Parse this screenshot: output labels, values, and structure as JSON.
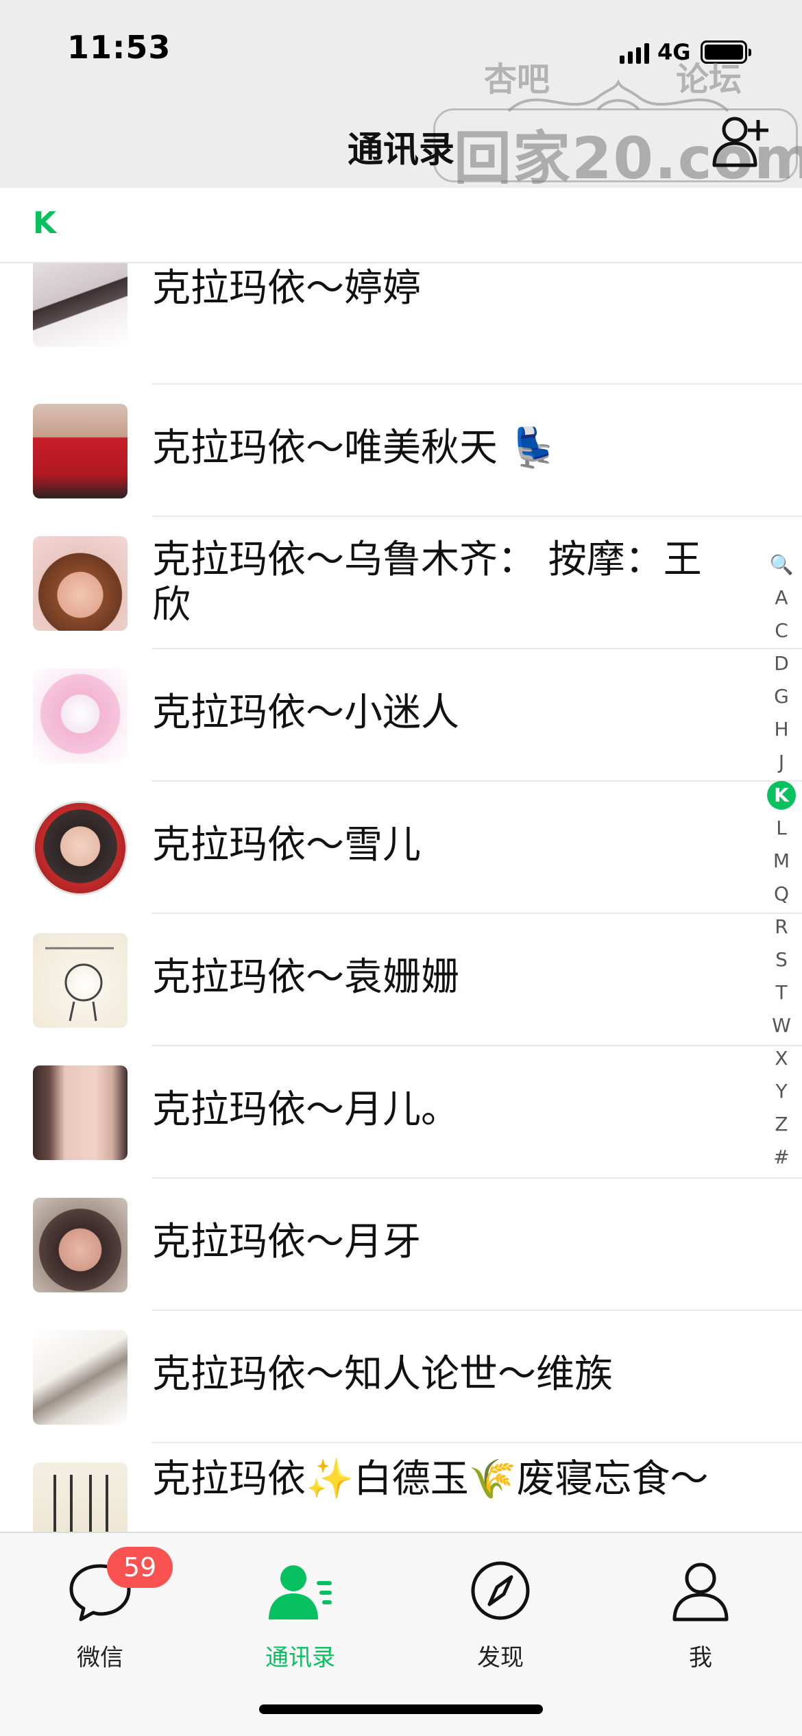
{
  "status_bar": {
    "time": "11:53",
    "network": "4G"
  },
  "nav": {
    "title": "通讯录",
    "add_friend_icon": "add-contact-icon"
  },
  "watermark": {
    "top_left": "杏吧",
    "top_right": "论坛",
    "main": "回家20.com"
  },
  "section": {
    "letter": "K"
  },
  "contacts": [
    {
      "name": "克拉玛依～婷婷"
    },
    {
      "name": "克拉玛依～唯美秋天 💺"
    },
    {
      "name": "克拉玛依～乌鲁木齐： 按摩：王欣"
    },
    {
      "name": "克拉玛依～小迷人"
    },
    {
      "name": "克拉玛依～雪儿"
    },
    {
      "name": "克拉玛依～袁姗姗"
    },
    {
      "name": "克拉玛依～月儿。"
    },
    {
      "name": "克拉玛依～月牙"
    },
    {
      "name": "克拉玛依～知人论世～维族"
    },
    {
      "name": "克拉玛依✨白德玉🌾废寝忘食～"
    }
  ],
  "index_bar": {
    "items": [
      "🔍",
      "A",
      "C",
      "D",
      "G",
      "H",
      "J",
      "K",
      "L",
      "M",
      "Q",
      "R",
      "S",
      "T",
      "W",
      "X",
      "Y",
      "Z",
      "#"
    ],
    "active": "K"
  },
  "tab_bar": {
    "tabs": [
      {
        "label": "微信",
        "icon": "chat-bubble-icon",
        "badge": "59"
      },
      {
        "label": "通讯录",
        "icon": "contacts-icon",
        "active": true
      },
      {
        "label": "发现",
        "icon": "compass-icon"
      },
      {
        "label": "我",
        "icon": "person-icon"
      }
    ]
  },
  "colors": {
    "accent": "#07c160",
    "badge": "#fa5151",
    "nav_bg": "#ededed",
    "tab_bg": "#f7f7f7"
  }
}
